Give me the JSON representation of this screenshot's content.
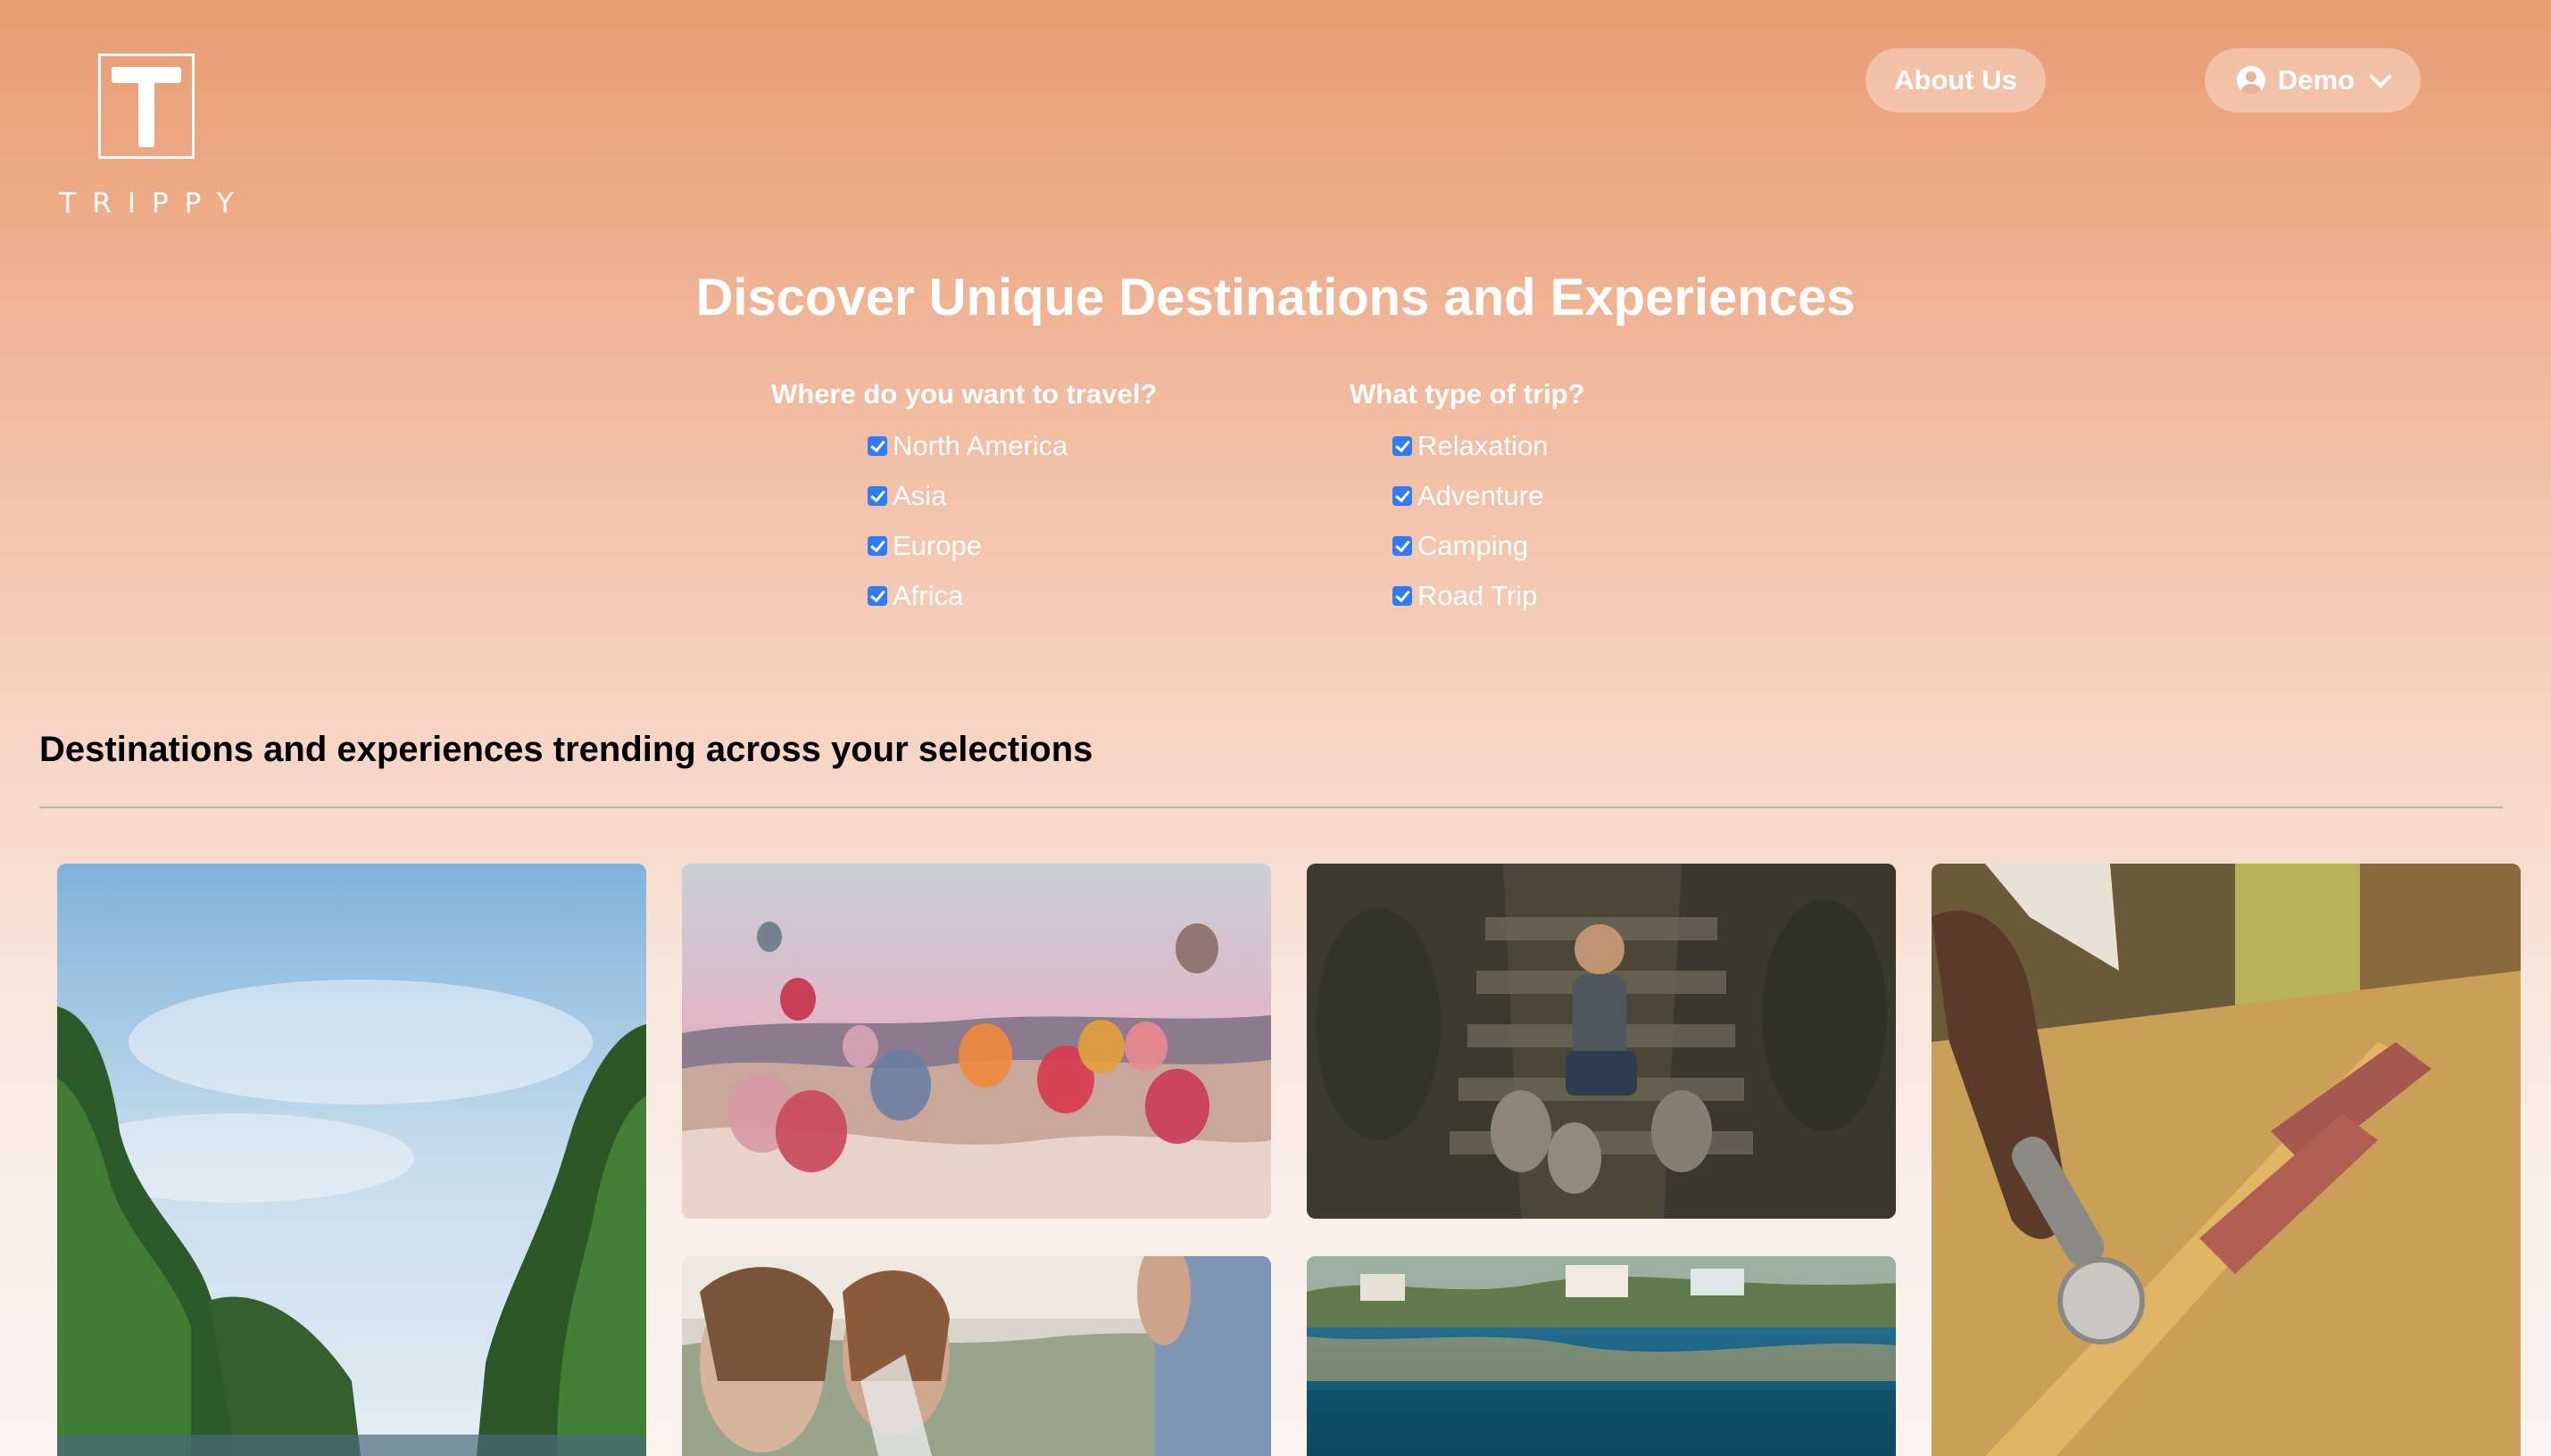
{
  "brand": {
    "name": "TRIPPY"
  },
  "header": {
    "about_label": "About Us",
    "user_label": "Demo"
  },
  "hero": {
    "title": "Discover Unique Destinations and Experiences"
  },
  "filters": {
    "destination": {
      "title": "Where do you want to travel?",
      "options": [
        {
          "label": "North America",
          "checked": true
        },
        {
          "label": "Asia",
          "checked": true
        },
        {
          "label": "Europe",
          "checked": true
        },
        {
          "label": "Africa",
          "checked": true
        }
      ]
    },
    "trip_type": {
      "title": "What type of trip?",
      "options": [
        {
          "label": "Relaxation",
          "checked": true
        },
        {
          "label": "Adventure",
          "checked": true
        },
        {
          "label": "Camping",
          "checked": true
        },
        {
          "label": "Road Trip",
          "checked": true
        }
      ]
    }
  },
  "trending": {
    "title": "Destinations and experiences trending across your selections"
  },
  "colors": {
    "accent_checkbox": "#2f7cf6",
    "header_gradient_top": "#e89d73",
    "header_gradient_bottom": "#fbf3ee"
  }
}
